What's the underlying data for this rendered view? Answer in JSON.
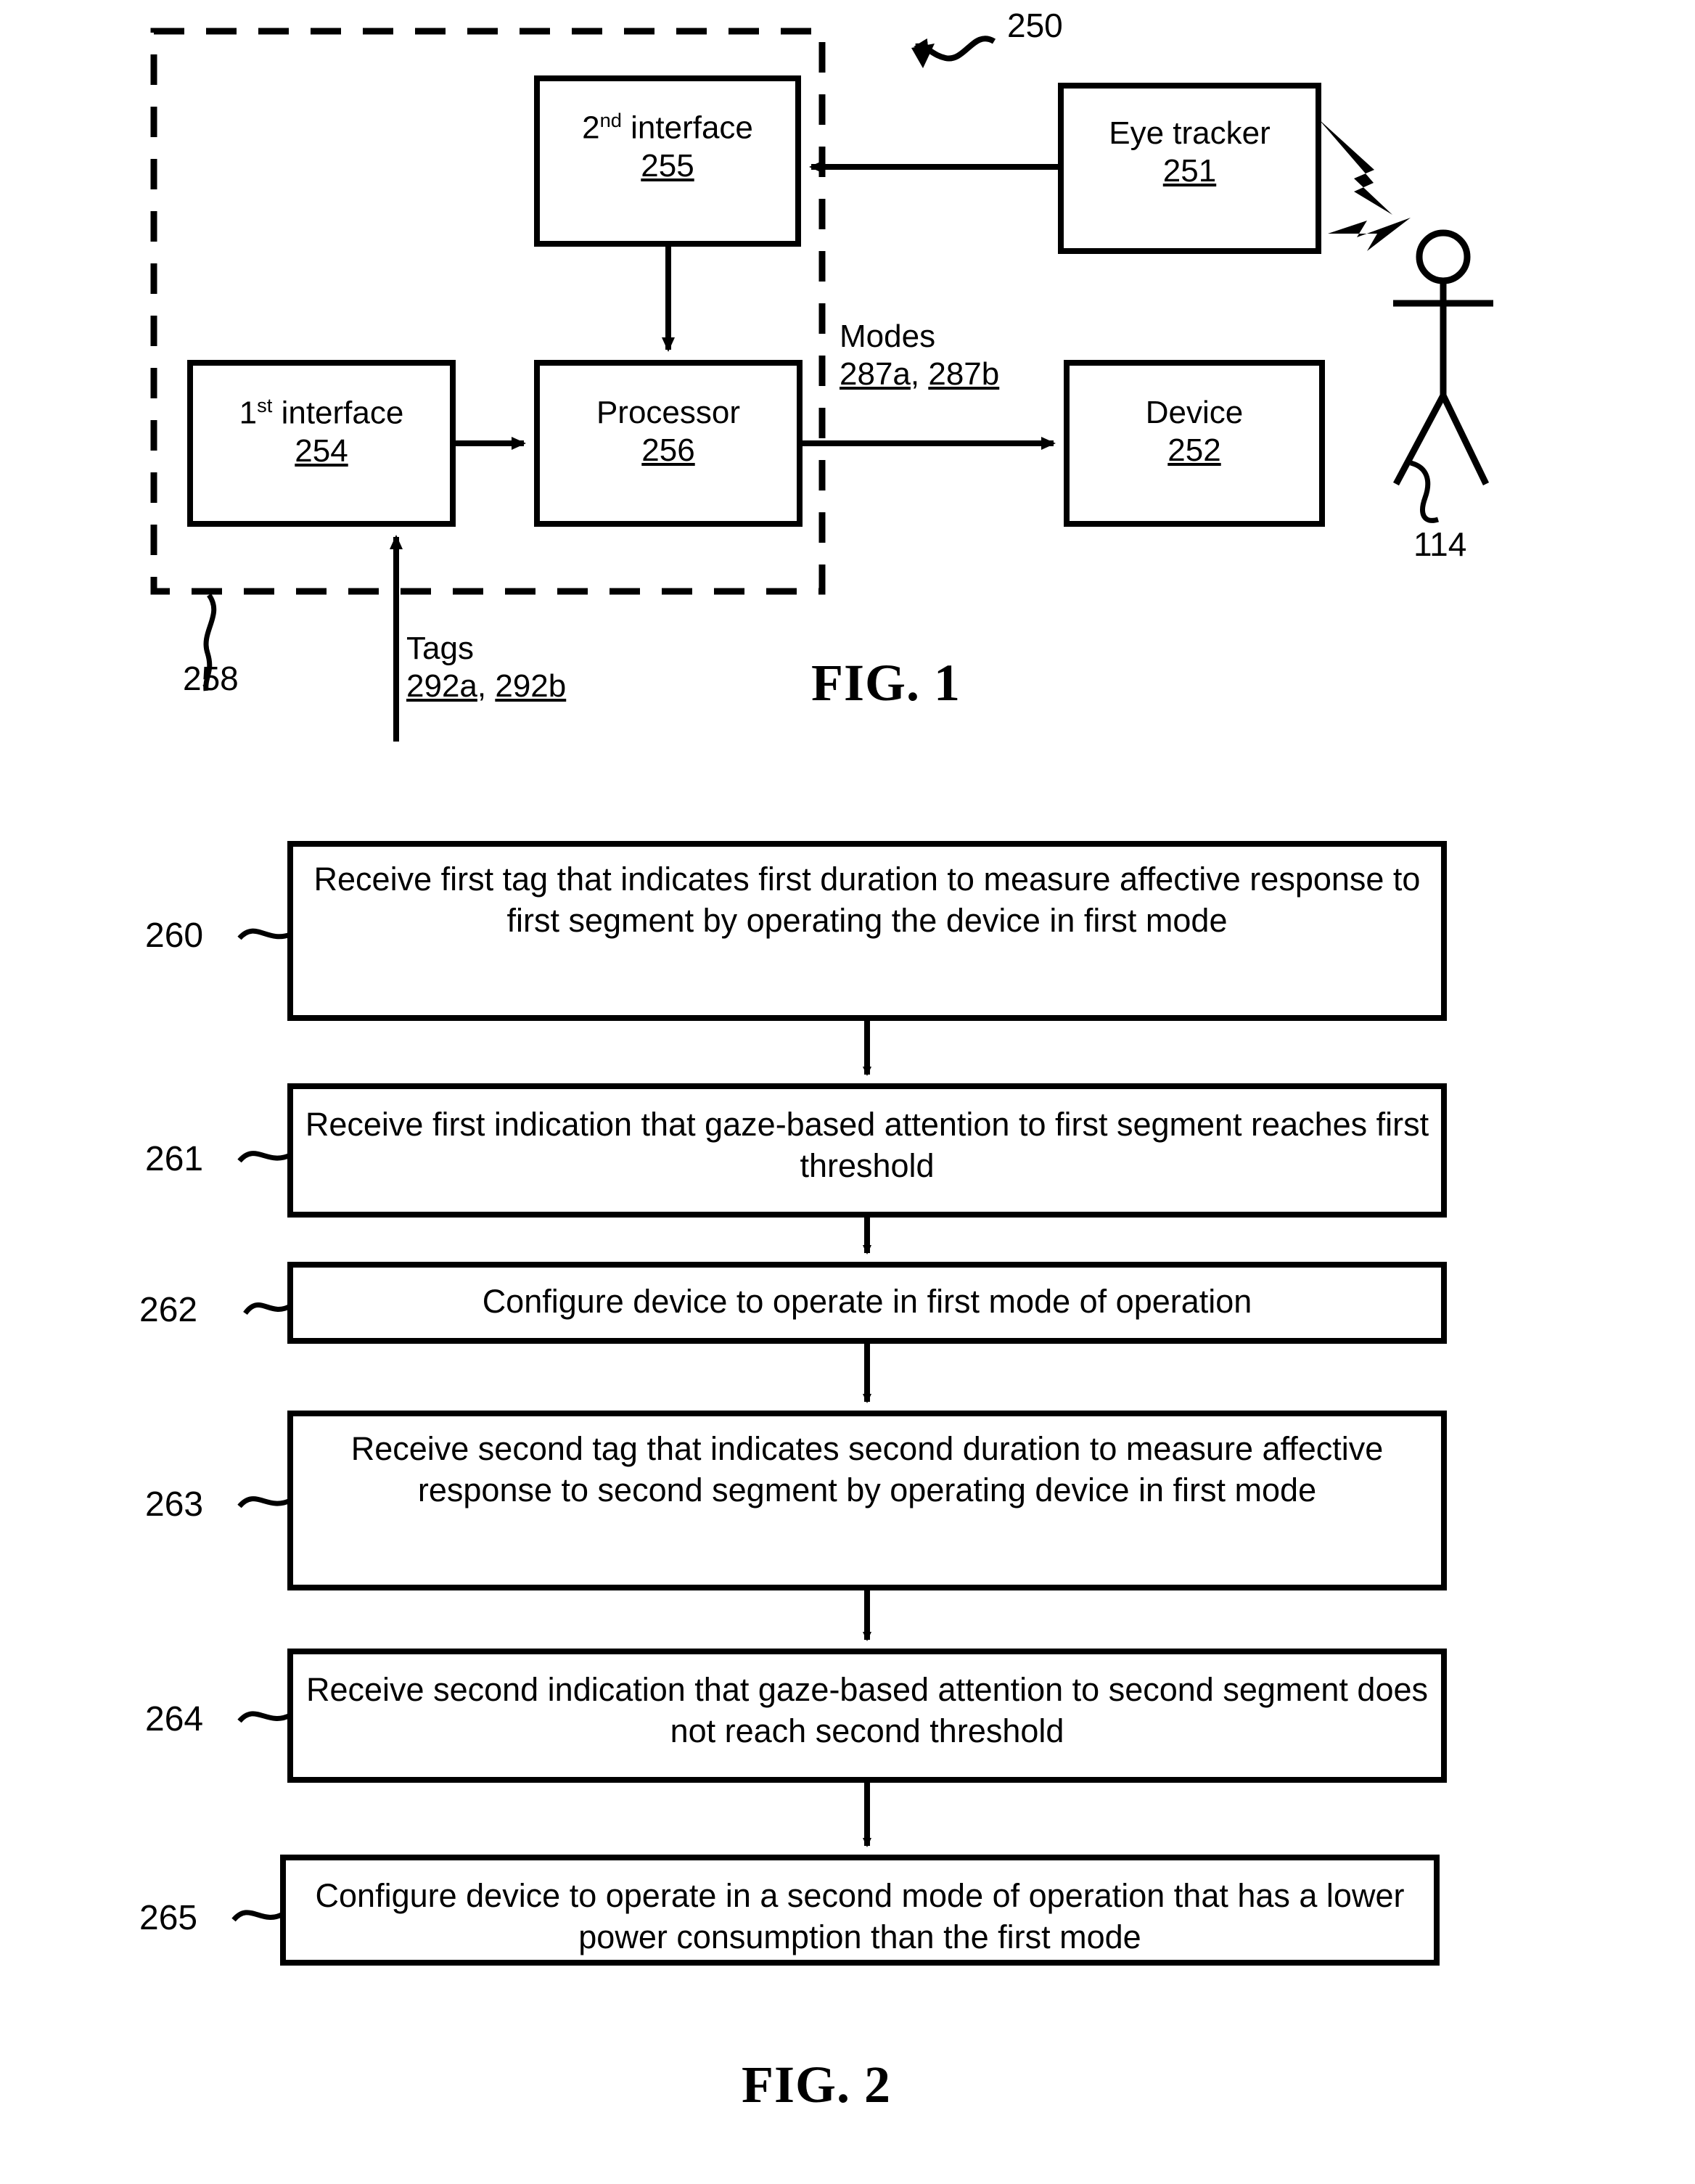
{
  "figure1": {
    "caption": "FIG. 1",
    "system_ref": "250",
    "dashed_group_ref": "258",
    "person_ref": "114",
    "blocks": [
      {
        "id": "second-interface",
        "line1_pre": "2",
        "line1_sup": "nd",
        "line1_post": " interface",
        "number": "255"
      },
      {
        "id": "first-interface",
        "line1_pre": "1",
        "line1_sup": "st",
        "line1_post": " interface",
        "number": "254"
      },
      {
        "id": "processor",
        "line1_pre": "Processor",
        "line1_sup": "",
        "line1_post": "",
        "number": "256"
      },
      {
        "id": "eye-tracker",
        "line1_pre": "Eye tracker",
        "line1_sup": "",
        "line1_post": "",
        "number": "251"
      },
      {
        "id": "device",
        "line1_pre": "Device",
        "line1_sup": "",
        "line1_post": "",
        "number": "252"
      }
    ],
    "modes_label": {
      "title": "Modes",
      "ref_a": "287a",
      "separator": ", ",
      "ref_b": "287b"
    },
    "tags_label": {
      "title": "Tags",
      "ref_a": "292a",
      "separator": ", ",
      "ref_b": "292b"
    }
  },
  "figure2": {
    "caption": "FIG. 2",
    "steps": [
      {
        "ref": "260",
        "text": "Receive first  tag that indicates first duration to measure affective response to first segment by operating the device in first mode"
      },
      {
        "ref": "261",
        "text": "Receive first indication that gaze-based attention to first segment reaches first threshold"
      },
      {
        "ref": "262",
        "text": "Configure device to operate in first mode of operation"
      },
      {
        "ref": "263",
        "text": "Receive second  tag that indicates second duration to measure affective response to second segment by operating device in first mode"
      },
      {
        "ref": "264",
        "text": "Receive second indication that gaze-based attention to second segment does not reach second threshold"
      },
      {
        "ref": "265",
        "text": "Configure device to operate in a second mode of operation that has a lower power consumption than the first mode"
      }
    ]
  },
  "colors": {
    "ink": "#000000",
    "paper": "#ffffff"
  }
}
